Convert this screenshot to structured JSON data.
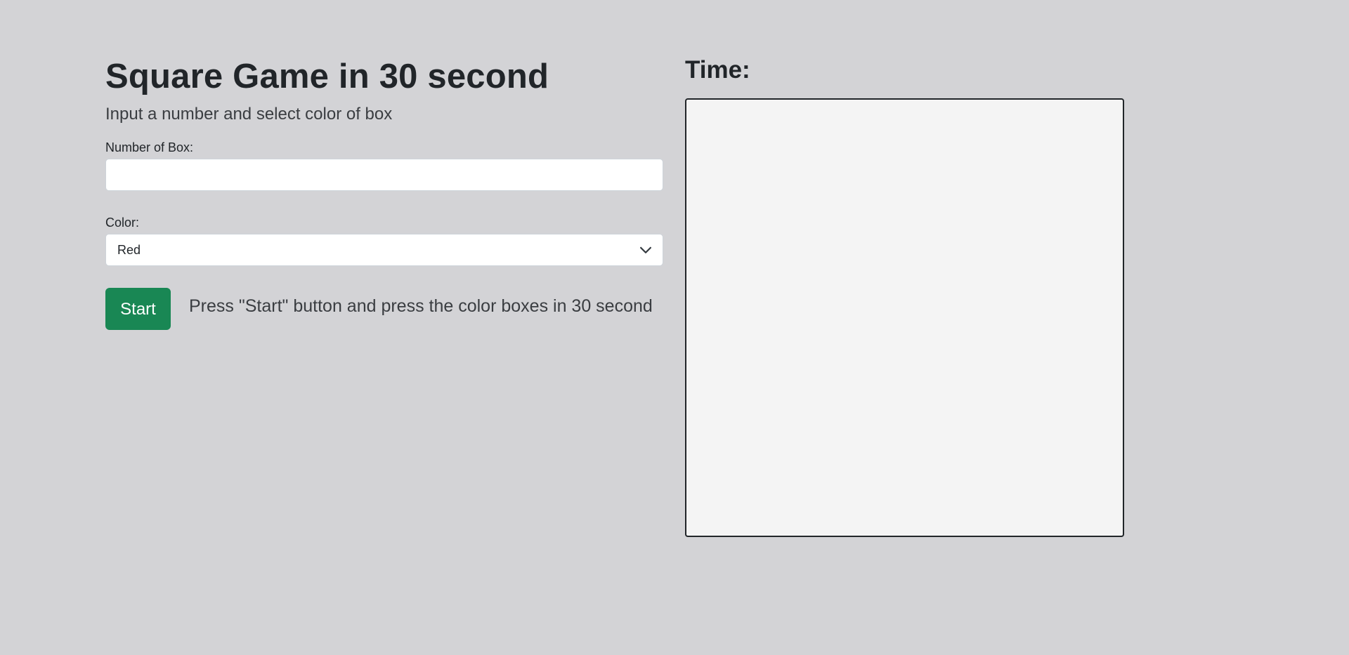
{
  "header": {
    "title": "Square Game in 30 second",
    "subtitle": "Input a number and select color of box"
  },
  "form": {
    "number_label": "Number of Box:",
    "number_value": "",
    "color_label": "Color:",
    "color_selected": "Red",
    "start_label": "Start",
    "instruction": "Press \"Start\" button and press the color boxes in 30 second"
  },
  "timer": {
    "label": "Time:",
    "value": ""
  },
  "icons": {
    "select_chevron": "chevron-down-icon"
  },
  "colors": {
    "background": "#d3d3d6",
    "start_button": "#198754",
    "board_background": "#f4f4f4"
  }
}
